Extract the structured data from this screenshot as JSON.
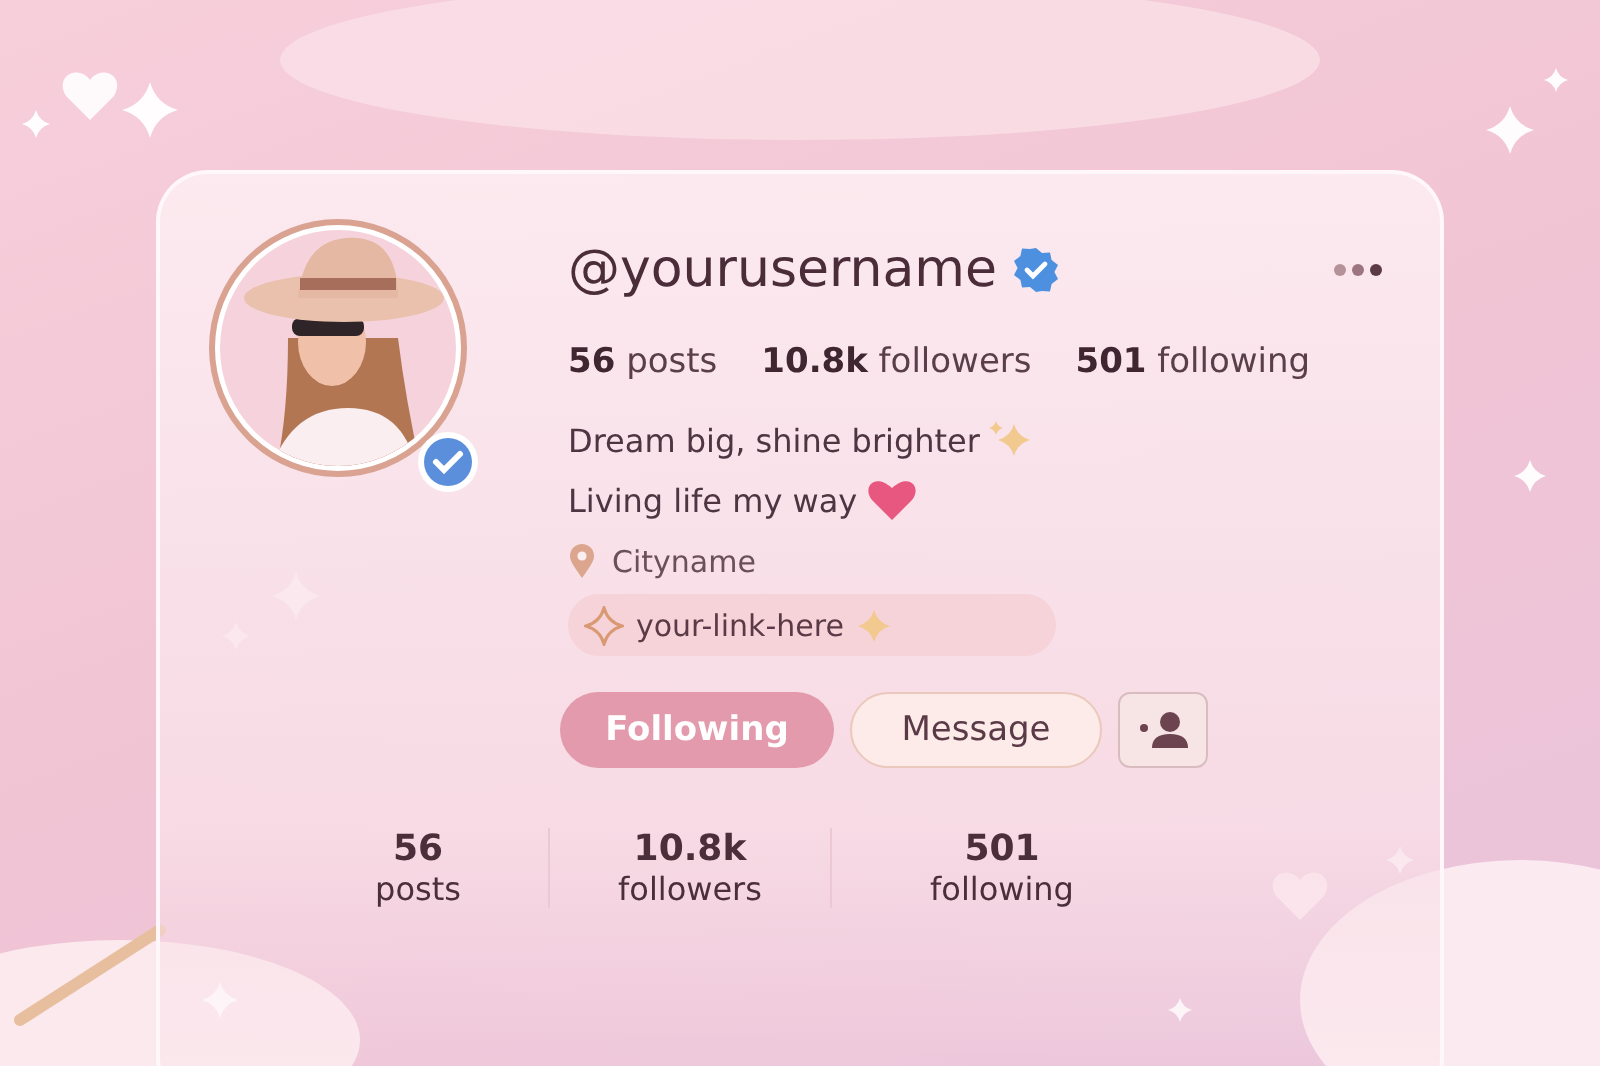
{
  "profile": {
    "username": "@yourusername",
    "verified": true,
    "stats": [
      {
        "count": "56",
        "label": "posts"
      },
      {
        "count": "10.8k",
        "label": "followers"
      },
      {
        "count": "501",
        "label": "following"
      }
    ],
    "bio": [
      {
        "text": "Dream big, shine brighter",
        "kind": "sparkles"
      },
      {
        "text": "Living life my way",
        "kind": "heart"
      }
    ],
    "location": "Cityname",
    "link": "your-link-here",
    "buttons": [
      {
        "kind": "primary",
        "label": "Following"
      },
      {
        "kind": "secondary",
        "label": "Message"
      },
      {
        "kind": "icon"
      }
    ]
  },
  "summary": [
    {
      "count": "56",
      "label": "posts"
    },
    {
      "count": "10.8k",
      "label": "followers"
    },
    {
      "count": "501",
      "label": "following"
    }
  ]
}
